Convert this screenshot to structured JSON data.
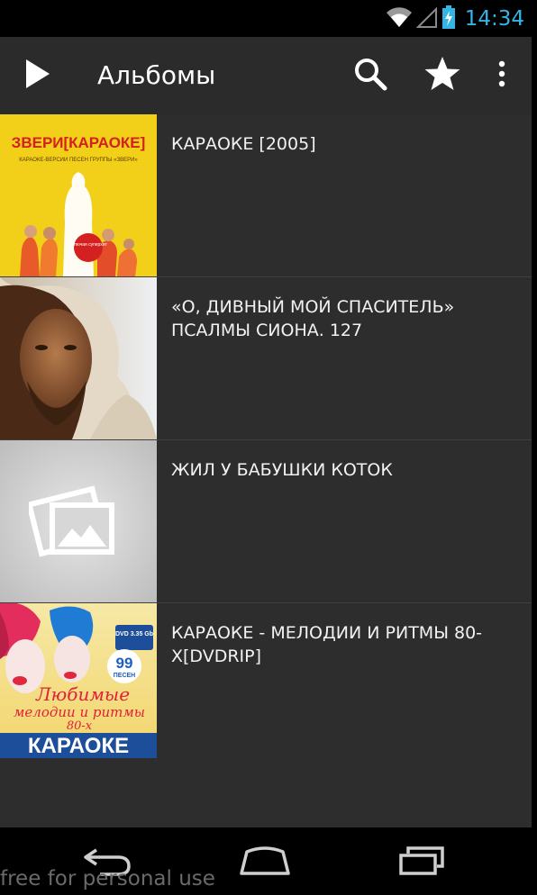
{
  "status_bar": {
    "time": "14:34",
    "icons": [
      "wifi-icon",
      "signal-icon",
      "battery-charging-icon"
    ],
    "accent_color": "#33b5e5"
  },
  "action_bar": {
    "title": "Альбомы",
    "icons": [
      "play-icon",
      "search-icon",
      "star-icon",
      "overflow-menu-icon"
    ]
  },
  "albums": [
    {
      "title": "КАРАОКЕ [2005]",
      "cover_text": {
        "heading": "ЗВЕРИ[КАРАОКЕ]",
        "subheading": "КАРАОКЕ-ВЕРСИИ ПЕСЕН ГРУППЫ «ЗВЕРИ»",
        "sticker": "включая суперхит"
      }
    },
    {
      "title": "«О, ДИВНЫЙ МОЙ СПАСИТЕЛЬ» ПСАЛМЫ СИОНА. 127"
    },
    {
      "title": "ЖИЛ У БАБУШКИ КОТОК",
      "placeholder_icon": "image-placeholder-icon"
    },
    {
      "title": "КАРАОКЕ - МЕЛОДИИ И РИТМЫ 80-Х[DVDRIP]",
      "cover_text": {
        "badge": "DVD 3.35 Gb",
        "songs_number": "99",
        "songs_word": "ПЕСЕН",
        "line1": "Любимые",
        "line2": "мелодии и ритмы",
        "line3": "80-х",
        "footer": "КАРАОКЕ"
      }
    }
  ],
  "nav_bar": {
    "icons": [
      "back-icon",
      "home-icon",
      "recent-apps-icon"
    ]
  },
  "watermark": "free for personal use"
}
